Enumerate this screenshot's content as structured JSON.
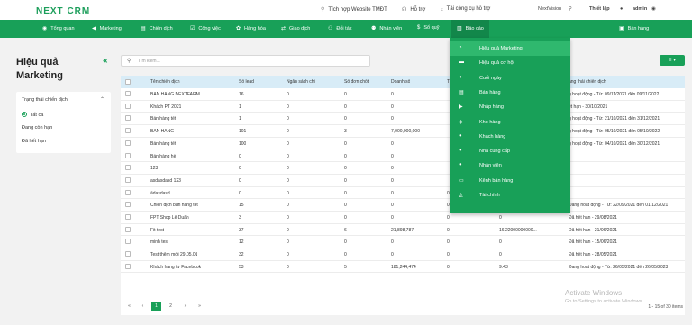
{
  "brand": {
    "logo": "NEXT CRM",
    "color": "#18a058"
  },
  "topbar": {
    "links": [
      {
        "label": "Tích hợp Website TMĐT",
        "icon": "pin-icon"
      },
      {
        "label": "Hỗ trợ",
        "icon": "headset-icon"
      },
      {
        "label": "Tải công cụ hỗ trợ",
        "icon": "download-icon"
      }
    ],
    "company": "NextVision",
    "settings_label": "Thiết lập",
    "user": "admin"
  },
  "nav": {
    "items": [
      {
        "label": "Tổng quan",
        "icon": "dashboard-icon",
        "glyph": "◉"
      },
      {
        "label": "Marketing",
        "icon": "megaphone-icon",
        "glyph": "◀"
      },
      {
        "label": "Chiến dịch",
        "icon": "campaign-icon",
        "glyph": "▤"
      },
      {
        "label": "Công việc",
        "icon": "task-icon",
        "glyph": "☑"
      },
      {
        "label": "Hàng hóa",
        "icon": "goods-icon",
        "glyph": "✿"
      },
      {
        "label": "Giao dịch",
        "icon": "transaction-icon",
        "glyph": "⇄"
      },
      {
        "label": "Đối tác",
        "icon": "partner-icon",
        "glyph": "⚇"
      },
      {
        "label": "Nhân viên",
        "icon": "staff-icon",
        "glyph": "⚉"
      },
      {
        "label": "Sổ quỹ",
        "icon": "cashbook-icon",
        "glyph": "$"
      },
      {
        "label": "Báo cáo",
        "icon": "report-icon",
        "glyph": "▥"
      }
    ],
    "sales_label": "Bán hàng",
    "sales_glyph": "▣"
  },
  "report_menu": {
    "items": [
      {
        "label": "Hiệu quả Marketing",
        "glyph": "◔"
      },
      {
        "label": "Hiệu quả cơ hội",
        "glyph": "▬"
      },
      {
        "label": "Cuối ngày",
        "glyph": "◑"
      },
      {
        "label": "Bán hàng",
        "glyph": "▤"
      },
      {
        "label": "Nhập hàng",
        "glyph": "▶"
      },
      {
        "label": "Kho hàng",
        "glyph": "◈"
      },
      {
        "label": "Khách hàng",
        "glyph": "●"
      },
      {
        "label": "Nhà cung cấp",
        "glyph": "●"
      },
      {
        "label": "Nhân viên",
        "glyph": "●"
      },
      {
        "label": "Kênh bán hàng",
        "glyph": "▭"
      },
      {
        "label": "Tài chính",
        "glyph": "◭"
      }
    ]
  },
  "page": {
    "title": "Hiệu quả Marketing",
    "collapse": "«"
  },
  "filter": {
    "heading": "Trạng thái chiến dịch",
    "options": [
      "Tất cả",
      "Đang còn hạn",
      "Đã hết hạn"
    ],
    "selected": 0
  },
  "search": {
    "placeholder": "Tìm kiếm..."
  },
  "view_button": "≡ ▾",
  "table": {
    "columns": [
      "Tên chiến dịch",
      "Số lead",
      "Ngân sách chi",
      "Số đơn chốt",
      "Doanh số",
      "T",
      "",
      "ạng thái chiến dịch"
    ],
    "rows": [
      [
        "BÁN HÀNG NEXTFARM",
        "16",
        "0",
        "0",
        "0",
        "",
        "",
        "g hoạt động - Từ: 09/11/2021 đến 09/11/2022"
      ],
      [
        "Khách PT 2021",
        "1",
        "0",
        "0",
        "0",
        "",
        "",
        "ết hạn - 30/10/2021"
      ],
      [
        "Bán hàng tết",
        "1",
        "0",
        "0",
        "0",
        "",
        "",
        "g hoạt động - Từ: 21/10/2021 đến 31/12/2021"
      ],
      [
        "BÁN HÀNG",
        "101",
        "0",
        "3",
        "7,000,000,000",
        "",
        "",
        "g hoạt động - Từ: 05/10/2021 đến 05/10/2022"
      ],
      [
        "Bán hàng tết",
        "100",
        "0",
        "0",
        "0",
        "",
        "",
        "g hoạt động - Từ: 04/10/2021 đến 30/12/2021"
      ],
      [
        "Bán hàng hè",
        "0",
        "0",
        "0",
        "0",
        "",
        "",
        ""
      ],
      [
        "123",
        "0",
        "0",
        "0",
        "0",
        "",
        "",
        ""
      ],
      [
        "asdasdasd 123",
        "0",
        "0",
        "0",
        "0",
        "",
        "",
        ""
      ],
      [
        "ấdasdasd",
        "0",
        "0",
        "0",
        "0",
        "0",
        "0",
        ""
      ],
      [
        "Chiến dịch bán hàng tết",
        "15",
        "0",
        "0",
        "0",
        "0",
        "0",
        "Đang hoạt động - Từ: 22/09/2021 đến 01/12/2021"
      ],
      [
        "FPT Shop Lê Duẩn",
        "3",
        "0",
        "0",
        "0",
        "0",
        "0",
        "Đã hết hạn - 29/08/2021"
      ],
      [
        "Fit test",
        "37",
        "0",
        "6",
        "21,898,787",
        "0",
        "16.22000000000...",
        "Đã hết hạn - 21/06/2021"
      ],
      [
        "minh test",
        "12",
        "0",
        "0",
        "0",
        "0",
        "0",
        "Đã hết hạn - 15/06/2021"
      ],
      [
        "Test thêm mới 29.05.01",
        "32",
        "0",
        "0",
        "0",
        "0",
        "0",
        "Đã hết hạn - 28/05/2021"
      ],
      [
        "Khách hàng từ Facebook",
        "53",
        "0",
        "5",
        "181,244,474",
        "0",
        "9.43",
        "Đang hoạt động - Từ: 26/05/2021 đến 26/05/2023"
      ]
    ]
  },
  "pagination": {
    "first": "«",
    "prev": "‹",
    "pages": [
      "1",
      "2"
    ],
    "next": "›",
    "last": "»",
    "info": "1 - 15 of 30 items",
    "active": 0
  },
  "watermark": {
    "title": "Activate Windows",
    "subtitle": "Go to Settings to activate Windows."
  }
}
